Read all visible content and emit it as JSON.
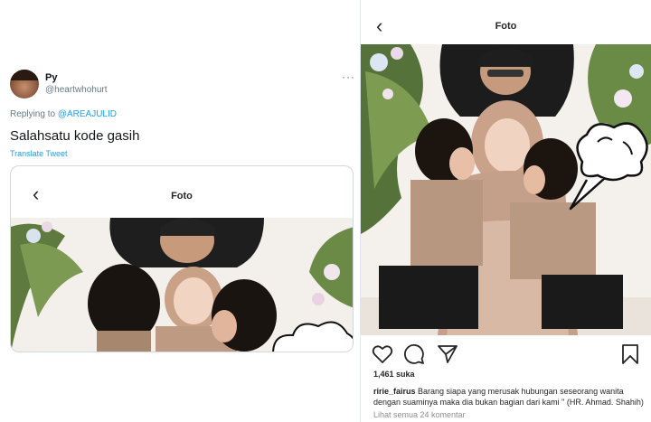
{
  "tweet": {
    "author_name": "Py",
    "author_handle": "@heartwhohurt",
    "more_label": "···",
    "replying_prefix": "Replying to ",
    "replying_to": "@AREAJULID",
    "text": "Salahsatu kode gasih",
    "translate_label": "Translate Tweet",
    "embedded_header": {
      "back_icon": "‹",
      "title": "Foto"
    }
  },
  "instagram": {
    "back_icon": "‹",
    "title": "Foto",
    "likes": "1,461 suka",
    "caption_user": "ririe_fairus",
    "caption_text": " Barang siapa yang merusak hubungan seseorang wanita dengan suaminya maka dia bukan bagian dari kami \" (HR. Ahmad. Shahih)",
    "view_comments": "Lihat semua 24 komentar",
    "icons": [
      "heart-icon",
      "comment-icon",
      "share-icon",
      "bookmark-icon"
    ]
  },
  "colors": {
    "twitter_blue": "#1da1f2",
    "muted": "#657786",
    "ig_text": "#262626",
    "ig_muted": "#8e8e8e"
  }
}
